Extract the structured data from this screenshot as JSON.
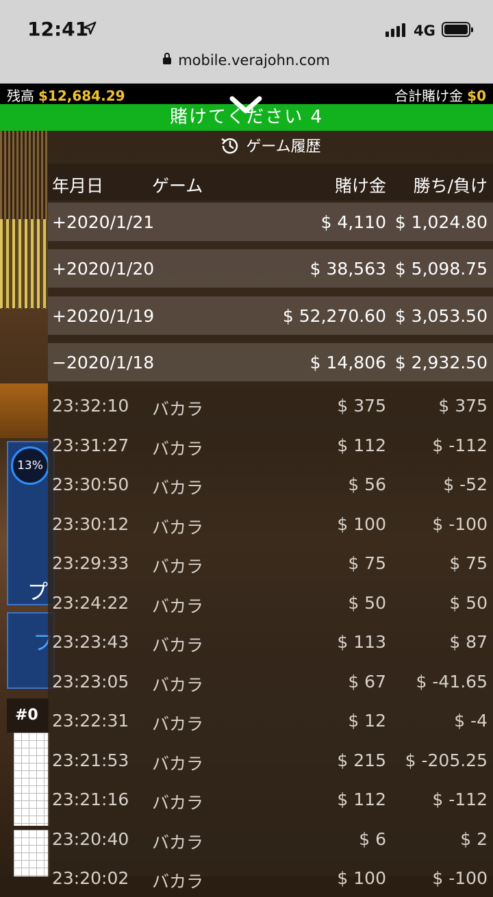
{
  "status_bar": {
    "time": "12:41",
    "network": "4G"
  },
  "browser": {
    "url": "mobile.verajohn.com"
  },
  "top_bar": {
    "balance_label": "残高",
    "balance_value": "$12,684.29",
    "total_bet_label": "合計賭け金",
    "total_bet_value": "$0"
  },
  "banner": {
    "text": "賭けてください 4"
  },
  "background": {
    "percent": "13%",
    "player_char": "プ",
    "player_char2": "フ",
    "road_label": "#0"
  },
  "history": {
    "title": "ゲーム履歴",
    "columns": {
      "date": "年月日",
      "game": "ゲーム",
      "bet": "賭け金",
      "win_loss": "勝ち/負け"
    },
    "days": [
      {
        "date": "+2020/1/21",
        "bet": "$ 4,110",
        "win_loss": "$ 1,024.80"
      },
      {
        "date": "+2020/1/20",
        "bet": "$ 38,563",
        "win_loss": "$ 5,098.75"
      },
      {
        "date": "+2020/1/19",
        "bet": "$ 52,270.60",
        "win_loss": "$ 3,053.50"
      },
      {
        "date": "−2020/1/18",
        "bet": "$ 14,806",
        "win_loss": "$ 2,932.50"
      }
    ],
    "rows": [
      {
        "time": "23:32:10",
        "game": "バカラ",
        "bet": "$ 375",
        "win_loss": "$ 375"
      },
      {
        "time": "23:31:27",
        "game": "バカラ",
        "bet": "$ 112",
        "win_loss": "$ -112"
      },
      {
        "time": "23:30:50",
        "game": "バカラ",
        "bet": "$ 56",
        "win_loss": "$ -52"
      },
      {
        "time": "23:30:12",
        "game": "バカラ",
        "bet": "$ 100",
        "win_loss": "$ -100"
      },
      {
        "time": "23:29:33",
        "game": "バカラ",
        "bet": "$ 75",
        "win_loss": "$ 75"
      },
      {
        "time": "23:24:22",
        "game": "バカラ",
        "bet": "$ 50",
        "win_loss": "$ 50"
      },
      {
        "time": "23:23:43",
        "game": "バカラ",
        "bet": "$ 113",
        "win_loss": "$ 87"
      },
      {
        "time": "23:23:05",
        "game": "バカラ",
        "bet": "$ 67",
        "win_loss": "$ -41.65"
      },
      {
        "time": "23:22:31",
        "game": "バカラ",
        "bet": "$ 12",
        "win_loss": "$ -4"
      },
      {
        "time": "23:21:53",
        "game": "バカラ",
        "bet": "$ 215",
        "win_loss": "$ -205.25"
      },
      {
        "time": "23:21:16",
        "game": "バカラ",
        "bet": "$ 112",
        "win_loss": "$ -112"
      },
      {
        "time": "23:20:40",
        "game": "バカラ",
        "bet": "$ 6",
        "win_loss": "$ 2"
      },
      {
        "time": "23:20:02",
        "game": "バカラ",
        "bet": "$ 100",
        "win_loss": "$ -100"
      }
    ]
  },
  "colors": {
    "green": "#12b11e",
    "gold": "#f2c230",
    "panel": "#30241a"
  }
}
